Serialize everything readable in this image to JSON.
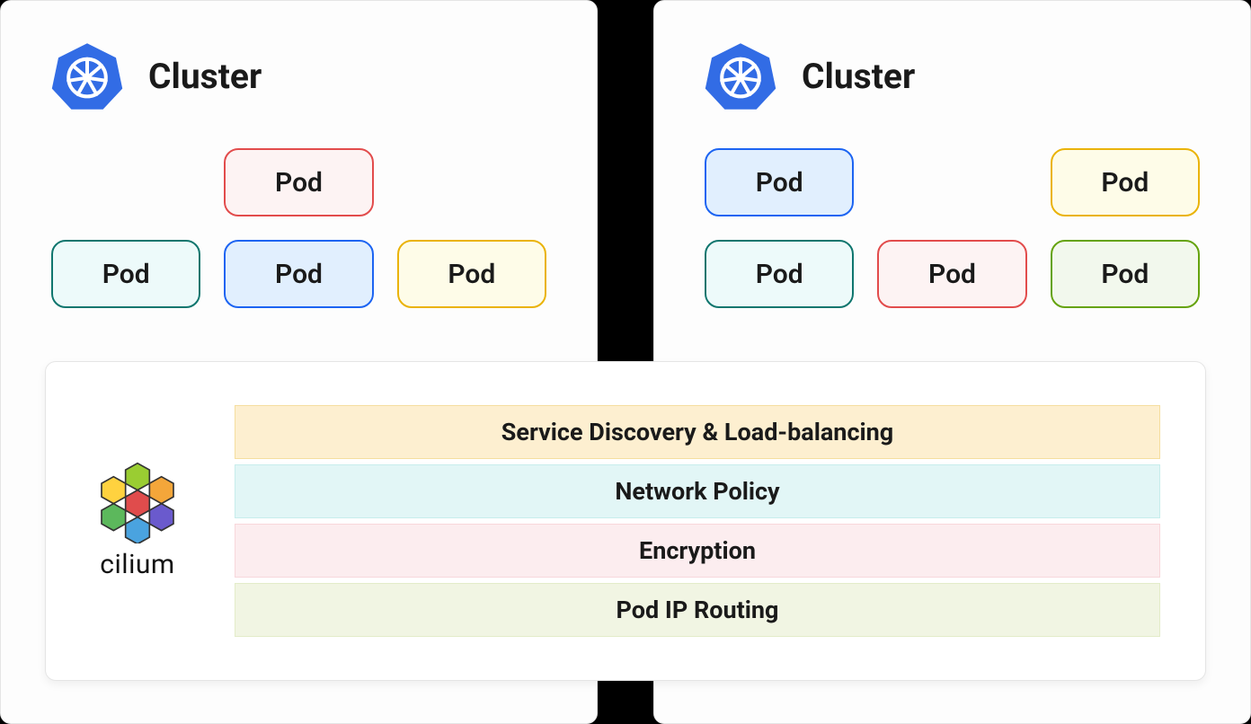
{
  "clusters": {
    "left": {
      "title": "Cluster",
      "pods": [
        {
          "label": "Pod",
          "color": "red",
          "row": 1,
          "col": 2
        },
        {
          "label": "Pod",
          "color": "teal",
          "row": 2,
          "col": 1
        },
        {
          "label": "Pod",
          "color": "blue",
          "row": 2,
          "col": 2
        },
        {
          "label": "Pod",
          "color": "yellow",
          "row": 2,
          "col": 3
        }
      ]
    },
    "right": {
      "title": "Cluster",
      "pods": [
        {
          "label": "Pod",
          "color": "blue",
          "row": 1,
          "col": 1
        },
        {
          "label": "Pod",
          "color": "yellow",
          "row": 1,
          "col": 3
        },
        {
          "label": "Pod",
          "color": "teal",
          "row": 2,
          "col": 1
        },
        {
          "label": "Pod",
          "color": "red",
          "row": 2,
          "col": 2
        },
        {
          "label": "Pod",
          "color": "green",
          "row": 2,
          "col": 3
        }
      ]
    }
  },
  "cilium": {
    "name": "cilium",
    "features": [
      {
        "label": "Service Discovery & Load-balancing",
        "color": "yellow"
      },
      {
        "label": "Network Policy",
        "color": "teal"
      },
      {
        "label": "Encryption",
        "color": "pink"
      },
      {
        "label": "Pod IP Routing",
        "color": "green"
      }
    ]
  }
}
